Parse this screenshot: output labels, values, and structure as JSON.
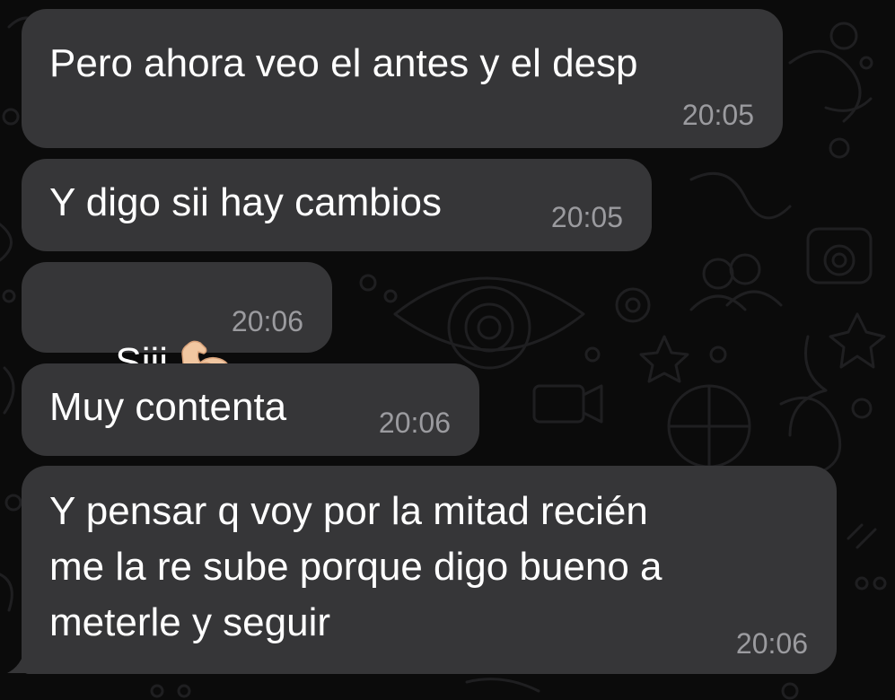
{
  "messages": [
    {
      "text": "Pero ahora veo el antes y el desp",
      "time": "20:05"
    },
    {
      "text": "Y digo sii hay cambios",
      "time": "20:05"
    },
    {
      "text": "Siii",
      "emoji": "flexed-biceps-icon",
      "time": "20:06"
    },
    {
      "text": "Muy contenta",
      "time": "20:06"
    },
    {
      "text": "Y pensar q voy por la mitad recién\nme la re sube porque digo bueno a\nmeterle y seguir",
      "time": "20:06"
    }
  ],
  "colors": {
    "background": "#0b0b0b",
    "bubble_incoming": "#363638",
    "text": "#ffffff",
    "timestamp": "#9b9b9f",
    "wallpaper_doodle": "#1c1c1e"
  }
}
